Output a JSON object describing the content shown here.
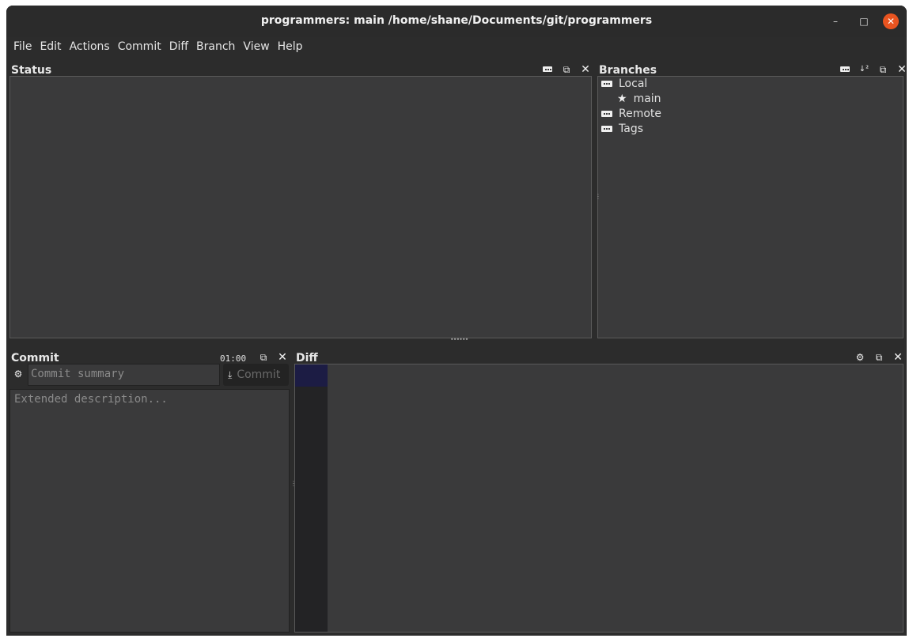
{
  "window": {
    "title": "programmers: main /home/shane/Documents/git/programmers",
    "controls": {
      "minimize": "–",
      "maximize": "□",
      "close": "✕"
    }
  },
  "menu": [
    "File",
    "Edit",
    "Actions",
    "Commit",
    "Diff",
    "Branch",
    "View",
    "Help"
  ],
  "status": {
    "title": "Status"
  },
  "branches": {
    "title": "Branches",
    "items": [
      {
        "label": "Local",
        "icon": "folder-dots-icon"
      },
      {
        "label": "main",
        "icon": "star-icon",
        "current": true
      },
      {
        "label": "Remote",
        "icon": "folder-dots-icon"
      },
      {
        "label": "Tags",
        "icon": "folder-dots-icon"
      }
    ]
  },
  "commit": {
    "title": "Commit",
    "timer": "01:00",
    "summary_placeholder": "Commit summary",
    "button_label": "Commit",
    "description_placeholder": "Extended description..."
  },
  "diff": {
    "title": "Diff"
  },
  "colors": {
    "accent_close": "#e95420",
    "panel": "#3a3a3b",
    "gutter_highlight": "#1c1c44"
  }
}
